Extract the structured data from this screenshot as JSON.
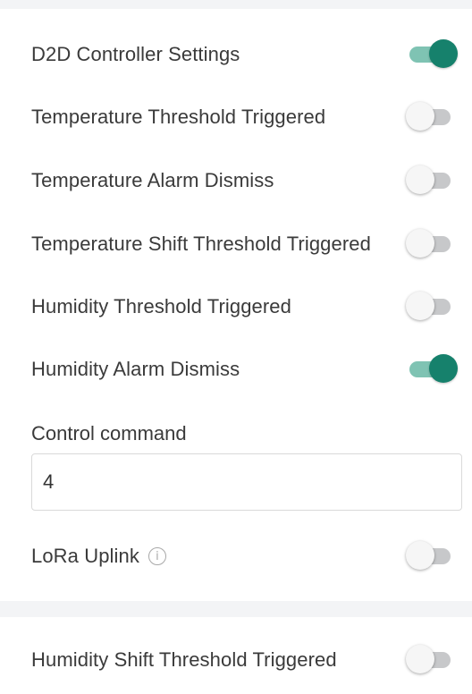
{
  "settings": [
    {
      "label": "D2D Controller Settings",
      "enabled": true
    },
    {
      "label": "Temperature Threshold Triggered",
      "enabled": false
    },
    {
      "label": "Temperature Alarm Dismiss",
      "enabled": false
    },
    {
      "label": "Temperature Shift Threshold Triggered",
      "enabled": false
    },
    {
      "label": "Humidity Threshold Triggered",
      "enabled": false
    },
    {
      "label": "Humidity Alarm Dismiss",
      "enabled": true
    }
  ],
  "control_command": {
    "label": "Control command",
    "value": "4"
  },
  "lora_uplink": {
    "label": "LoRa Uplink",
    "info_icon": "info-icon",
    "info_glyph": "i",
    "enabled": false
  },
  "humidity_shift": {
    "label": "Humidity Shift Threshold Triggered",
    "enabled": false
  },
  "colors": {
    "toggle_on_knob": "#16816c",
    "toggle_on_track": "#7fc3b3",
    "toggle_off_knob": "#f6f6f6",
    "toggle_off_track": "#c7c8ca"
  }
}
